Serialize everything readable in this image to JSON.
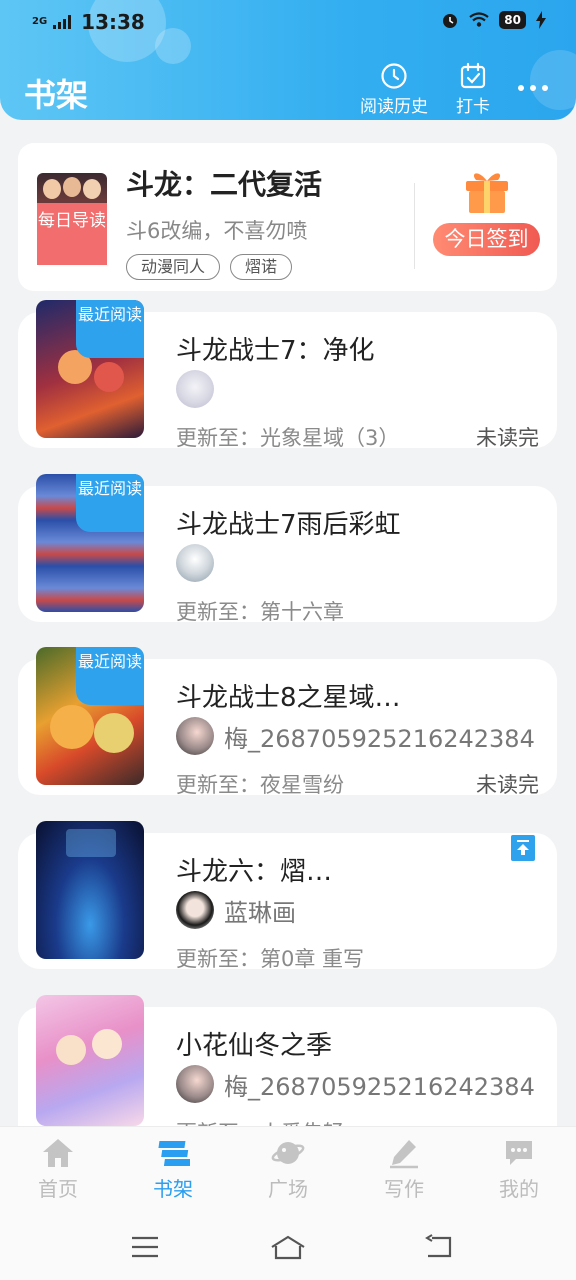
{
  "status_bar": {
    "network": "2G",
    "time": "13:38",
    "battery": "80"
  },
  "header": {
    "title": "书架",
    "history_label": "阅读历史",
    "checkin_label": "打卡"
  },
  "daily": {
    "badge": "每日导读",
    "title": "斗龙：二代复活",
    "subtitle": "斗6改编，不喜勿喷",
    "tags": [
      "动漫同人",
      "熠诺"
    ],
    "sign_label": "今日签到"
  },
  "books": [
    {
      "badge": "最近阅读",
      "title": "斗龙战士7：净化",
      "author": "",
      "update": "更新至：光象星域（3）",
      "status": "未读完"
    },
    {
      "badge": "最近阅读",
      "title": "斗龙战士7雨后彩虹",
      "author": "",
      "update": "更新至：第十六章",
      "status": ""
    },
    {
      "badge": "最近阅读",
      "title": "斗龙战士8之星域…",
      "author": "梅_268705925216242384",
      "update": "更新至：夜星雪纷",
      "status": "未读完"
    },
    {
      "badge": "",
      "title": "斗龙六：熠…",
      "author": "蓝琳画",
      "update": "更新至：第0章 重写",
      "status": ""
    },
    {
      "badge": "",
      "title": "小花仙冬之季",
      "author": "梅_268705925216242384",
      "update": "更新至：火爱告轻",
      "status": ""
    }
  ],
  "nav": {
    "home": "首页",
    "shelf": "书架",
    "square": "广场",
    "write": "写作",
    "mine": "我的"
  },
  "colors": {
    "accent": "#2a9ef0",
    "header": "#33aef0",
    "sign": "#f05a52"
  }
}
